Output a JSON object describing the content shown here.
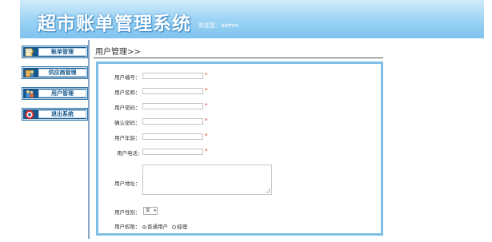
{
  "header": {
    "title": "超市账单管理系统",
    "welcome": "欢迎您：admin"
  },
  "sidebar": {
    "items": [
      {
        "label": "账单管理",
        "icon": "bill-icon"
      },
      {
        "label": "供应商管理",
        "icon": "supplier-icon"
      },
      {
        "label": "用户管理",
        "icon": "users-icon"
      },
      {
        "label": "退出系统",
        "icon": "lifebuoy-icon"
      }
    ]
  },
  "main": {
    "page_title": "用户管理>>",
    "fields": [
      {
        "label": "用户编号：",
        "value": "",
        "required": "*"
      },
      {
        "label": "用户名称：",
        "value": "",
        "required": "*"
      },
      {
        "label": "用户密码：",
        "value": "",
        "required": "*"
      },
      {
        "label": "确认密码：",
        "value": "",
        "required": "*"
      },
      {
        "label": "用户年龄：",
        "value": "",
        "required": "*"
      },
      {
        "label": "用户电话：",
        "value": "",
        "required": "*"
      }
    ],
    "address_label": "用户地址：",
    "address_value": "",
    "gender_label": "用户性别：",
    "gender_selected": "女",
    "role_label": "用户权限：",
    "role_options": [
      {
        "label": "普通用户",
        "checked": true
      },
      {
        "label": "经理",
        "checked": false
      }
    ]
  },
  "colors": {
    "header_gradient_top": "#d2ecfb",
    "header_gradient_bottom": "#7ec3ee",
    "nav_button": "#15578c",
    "form_border": "#7fbfe6",
    "required_star": "#e0251b"
  }
}
